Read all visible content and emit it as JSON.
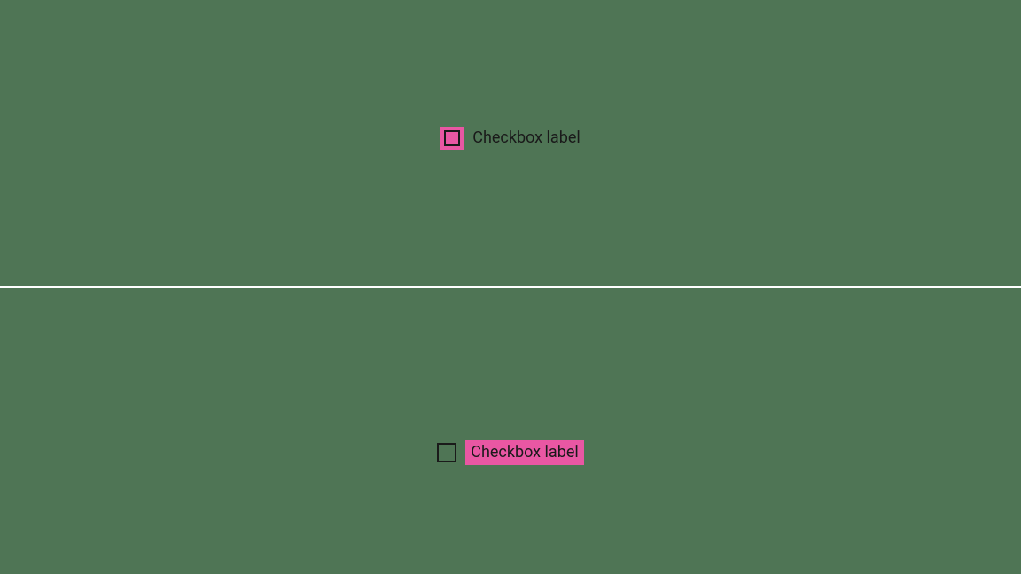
{
  "examples": {
    "top": {
      "label": "Checkbox label",
      "highlight_target": "checkbox"
    },
    "bottom": {
      "label": "Checkbox label",
      "highlight_target": "label"
    }
  },
  "colors": {
    "highlight": "#e957a3",
    "background": "#4f7555",
    "divider": "#ffffff",
    "text": "#1a1a1a"
  }
}
